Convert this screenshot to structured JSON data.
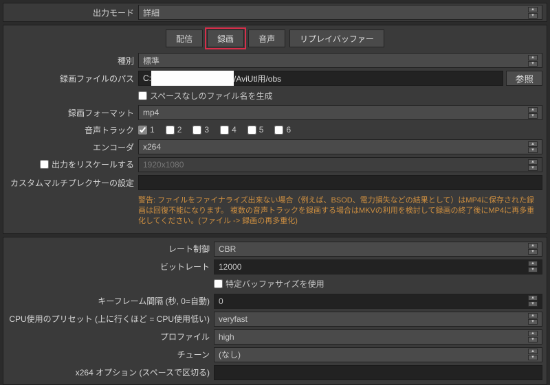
{
  "output_mode": {
    "label": "出力モード",
    "value": "詳細"
  },
  "tabs": {
    "stream": "配信",
    "record": "録画",
    "audio": "音声",
    "replay": "リプレイバッファー"
  },
  "kind": {
    "label": "種別",
    "value": "標準"
  },
  "rec_path": {
    "label": "録画ファイルのパス",
    "prefix": "C:",
    "suffix": "/AviUtl用/obs",
    "browse": "参照"
  },
  "no_space": {
    "label": "スペースなしのファイル名を生成"
  },
  "rec_format": {
    "label": "録画フォーマット",
    "value": "mp4"
  },
  "audio_track": {
    "label": "音声トラック",
    "options": [
      "1",
      "2",
      "3",
      "4",
      "5",
      "6"
    ],
    "checked": [
      true,
      false,
      false,
      false,
      false,
      false
    ]
  },
  "encoder": {
    "label": "エンコーダ",
    "value": "x264"
  },
  "rescale": {
    "label": "出力をリスケールする",
    "value": "1920x1080"
  },
  "mux": {
    "label": "カスタムマルチプレクサーの設定"
  },
  "warning": "警告: ファイルをファイナライズ出来ない場合（例えば、BSOD、電力損失などの結果として）はMP4に保存された録画は回復不能になります。 複数の音声トラックを録画する場合はMKVの利用を検討して録画の終了後にMP4に再多重化してください。(ファイル -> 録画の再多重化)",
  "rate": {
    "label": "レート制御",
    "value": "CBR"
  },
  "bitrate": {
    "label": "ビットレート",
    "value": "12000"
  },
  "custom_buf": {
    "label": "特定バッファサイズを使用"
  },
  "keyframe": {
    "label": "キーフレーム間隔 (秒, 0=自動)",
    "value": "0"
  },
  "cpu_preset": {
    "label": "CPU使用のプリセット (上に行くほど = CPU使用低い)",
    "value": "veryfast"
  },
  "profile": {
    "label": "プロファイル",
    "value": "high"
  },
  "tune": {
    "label": "チューン",
    "value": "(なし)"
  },
  "x264_opts": {
    "label": "x264 オプション (スペースで区切る)"
  }
}
